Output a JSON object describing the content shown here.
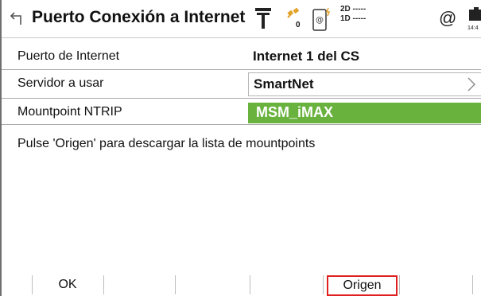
{
  "titlebar": {
    "title": "Puerto Conexión a Internet",
    "satellite_count": "0",
    "position_2d": "2D -----",
    "position_1d": "1D -----",
    "at_symbol": "@",
    "time": "14:4"
  },
  "form": {
    "rows": [
      {
        "label": "Puerto de Internet",
        "value": "Internet 1 del CS"
      },
      {
        "label": "Servidor a usar",
        "value": "SmartNet"
      },
      {
        "label": "Mountpoint NTRIP",
        "value": "MSM_iMAX"
      }
    ],
    "info_text": "Pulse 'Origen' para descargar la lista de mountpoints"
  },
  "bottombar": {
    "ok_label": "OK",
    "origen_label": "Origen"
  },
  "colors": {
    "accent_green": "#6ab23e",
    "highlight_red": "#e02020"
  },
  "icons": [
    "back-arrow-icon",
    "gnss-antenna-icon",
    "satellite-icon",
    "phone-internet-icon",
    "battery-icon",
    "chevron-right-icon"
  ]
}
